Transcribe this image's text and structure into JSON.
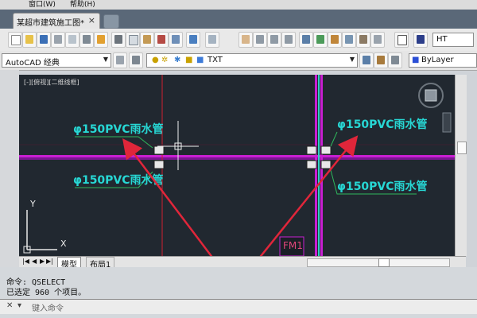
{
  "menu": {
    "items": [
      "窗口(W)",
      "帮助(H)"
    ]
  },
  "document_tab": {
    "title": "某超市建筑施工图*",
    "close": "×"
  },
  "toolbar_right": {
    "text_style": "HT"
  },
  "properties_bar": {
    "workspace": "AutoCAD 经典",
    "layer": "TXT",
    "color": "ByLayer"
  },
  "viewport": {
    "label": "[-][俯视][二维线框]"
  },
  "drawing": {
    "annotations": [
      "φ150PVC雨水管",
      "φ150PVC雨水管",
      "φ150PVC雨水管",
      "φ150PVC雨水管"
    ],
    "door_tag": "FM1",
    "ucs_y": "Y",
    "ucs_x": "X"
  },
  "layout_tabs": [
    "模型",
    "布局1"
  ],
  "command_window": {
    "history": [
      "命令: QSELECT",
      "已选定 960 个项目。"
    ],
    "prompt": "键入命令"
  },
  "colors": {
    "canvas": "#212830",
    "annotation": "#27d7d4",
    "axis_magenta": "#c81fd2",
    "axis_red": "#d02030",
    "arrow": "#e0263a",
    "leader": "#2fb85c"
  }
}
